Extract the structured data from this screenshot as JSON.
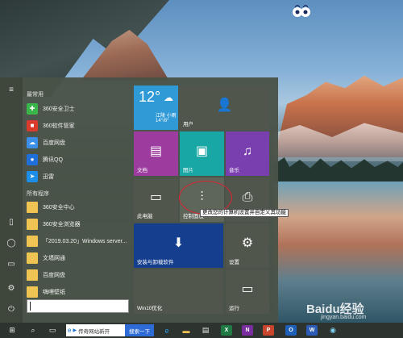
{
  "start_menu": {
    "sections": {
      "frequent": "最常用",
      "all_programs": "所有程序"
    },
    "frequent_apps": [
      {
        "label": "360安全卫士",
        "icon": "360-safe-icon"
      },
      {
        "label": "360软件管家",
        "icon": "360-software-manager-icon"
      },
      {
        "label": "百度网盘",
        "icon": "baidu-netdisk-icon"
      },
      {
        "label": "腾讯QQ",
        "icon": "qq-icon"
      },
      {
        "label": "迅雷",
        "icon": "xunlei-icon"
      }
    ],
    "all_apps": [
      {
        "label": "360安全中心",
        "icon": "folder-icon"
      },
      {
        "label": "360安全浏览器",
        "icon": "folder-icon"
      },
      {
        "label": "「2019.03.20」Windows server...",
        "icon": "folder-icon"
      },
      {
        "label": "文墙网通",
        "icon": "folder-icon"
      },
      {
        "label": "百度网盘",
        "icon": "folder-icon"
      },
      {
        "label": "嗨哩壁纸",
        "icon": "folder-icon"
      }
    ],
    "search_value": ""
  },
  "tiles": {
    "weather": {
      "temp": "12°",
      "line1": "江陵  小雨",
      "line2": "14°/8°",
      "color": "#2f9ad6"
    },
    "user": {
      "label": "用户"
    },
    "documents": {
      "label": "文档"
    },
    "pictures": {
      "label": "图片"
    },
    "music": {
      "label": "音乐"
    },
    "this_pc": {
      "label": "此电脑"
    },
    "control_panel": {
      "label": "控制面板"
    },
    "printer": {
      "label": ""
    },
    "install_uninstall": {
      "label": "安装与卸载软件"
    },
    "settings": {
      "label": "设置"
    },
    "win10_optimize": {
      "label": "Win10优化"
    },
    "run": {
      "label": "运行"
    },
    "tooltip": "更改您的计算机设置并自定义其功能"
  },
  "taskbar": {
    "search_text": "传奇网站新开",
    "search_button": "搜索一下",
    "apps": [
      "edge-icon",
      "file-explorer-icon",
      "store-icon",
      "excel-icon",
      "onenote-icon",
      "powerpoint-icon",
      "outlook-icon",
      "word-icon",
      "qq-browser-icon"
    ]
  },
  "watermark": {
    "brand": "Baidu经验",
    "url": "jingyan.baidu.com"
  },
  "colors": {
    "tile_gray": "#50564c",
    "tile_blue": "#2f9ad6",
    "tile_purple": "#9b3c9e",
    "tile_teal": "#19a7a5",
    "tile_violet": "#7a3fae",
    "tile_dark_blue": "#153f8e"
  }
}
